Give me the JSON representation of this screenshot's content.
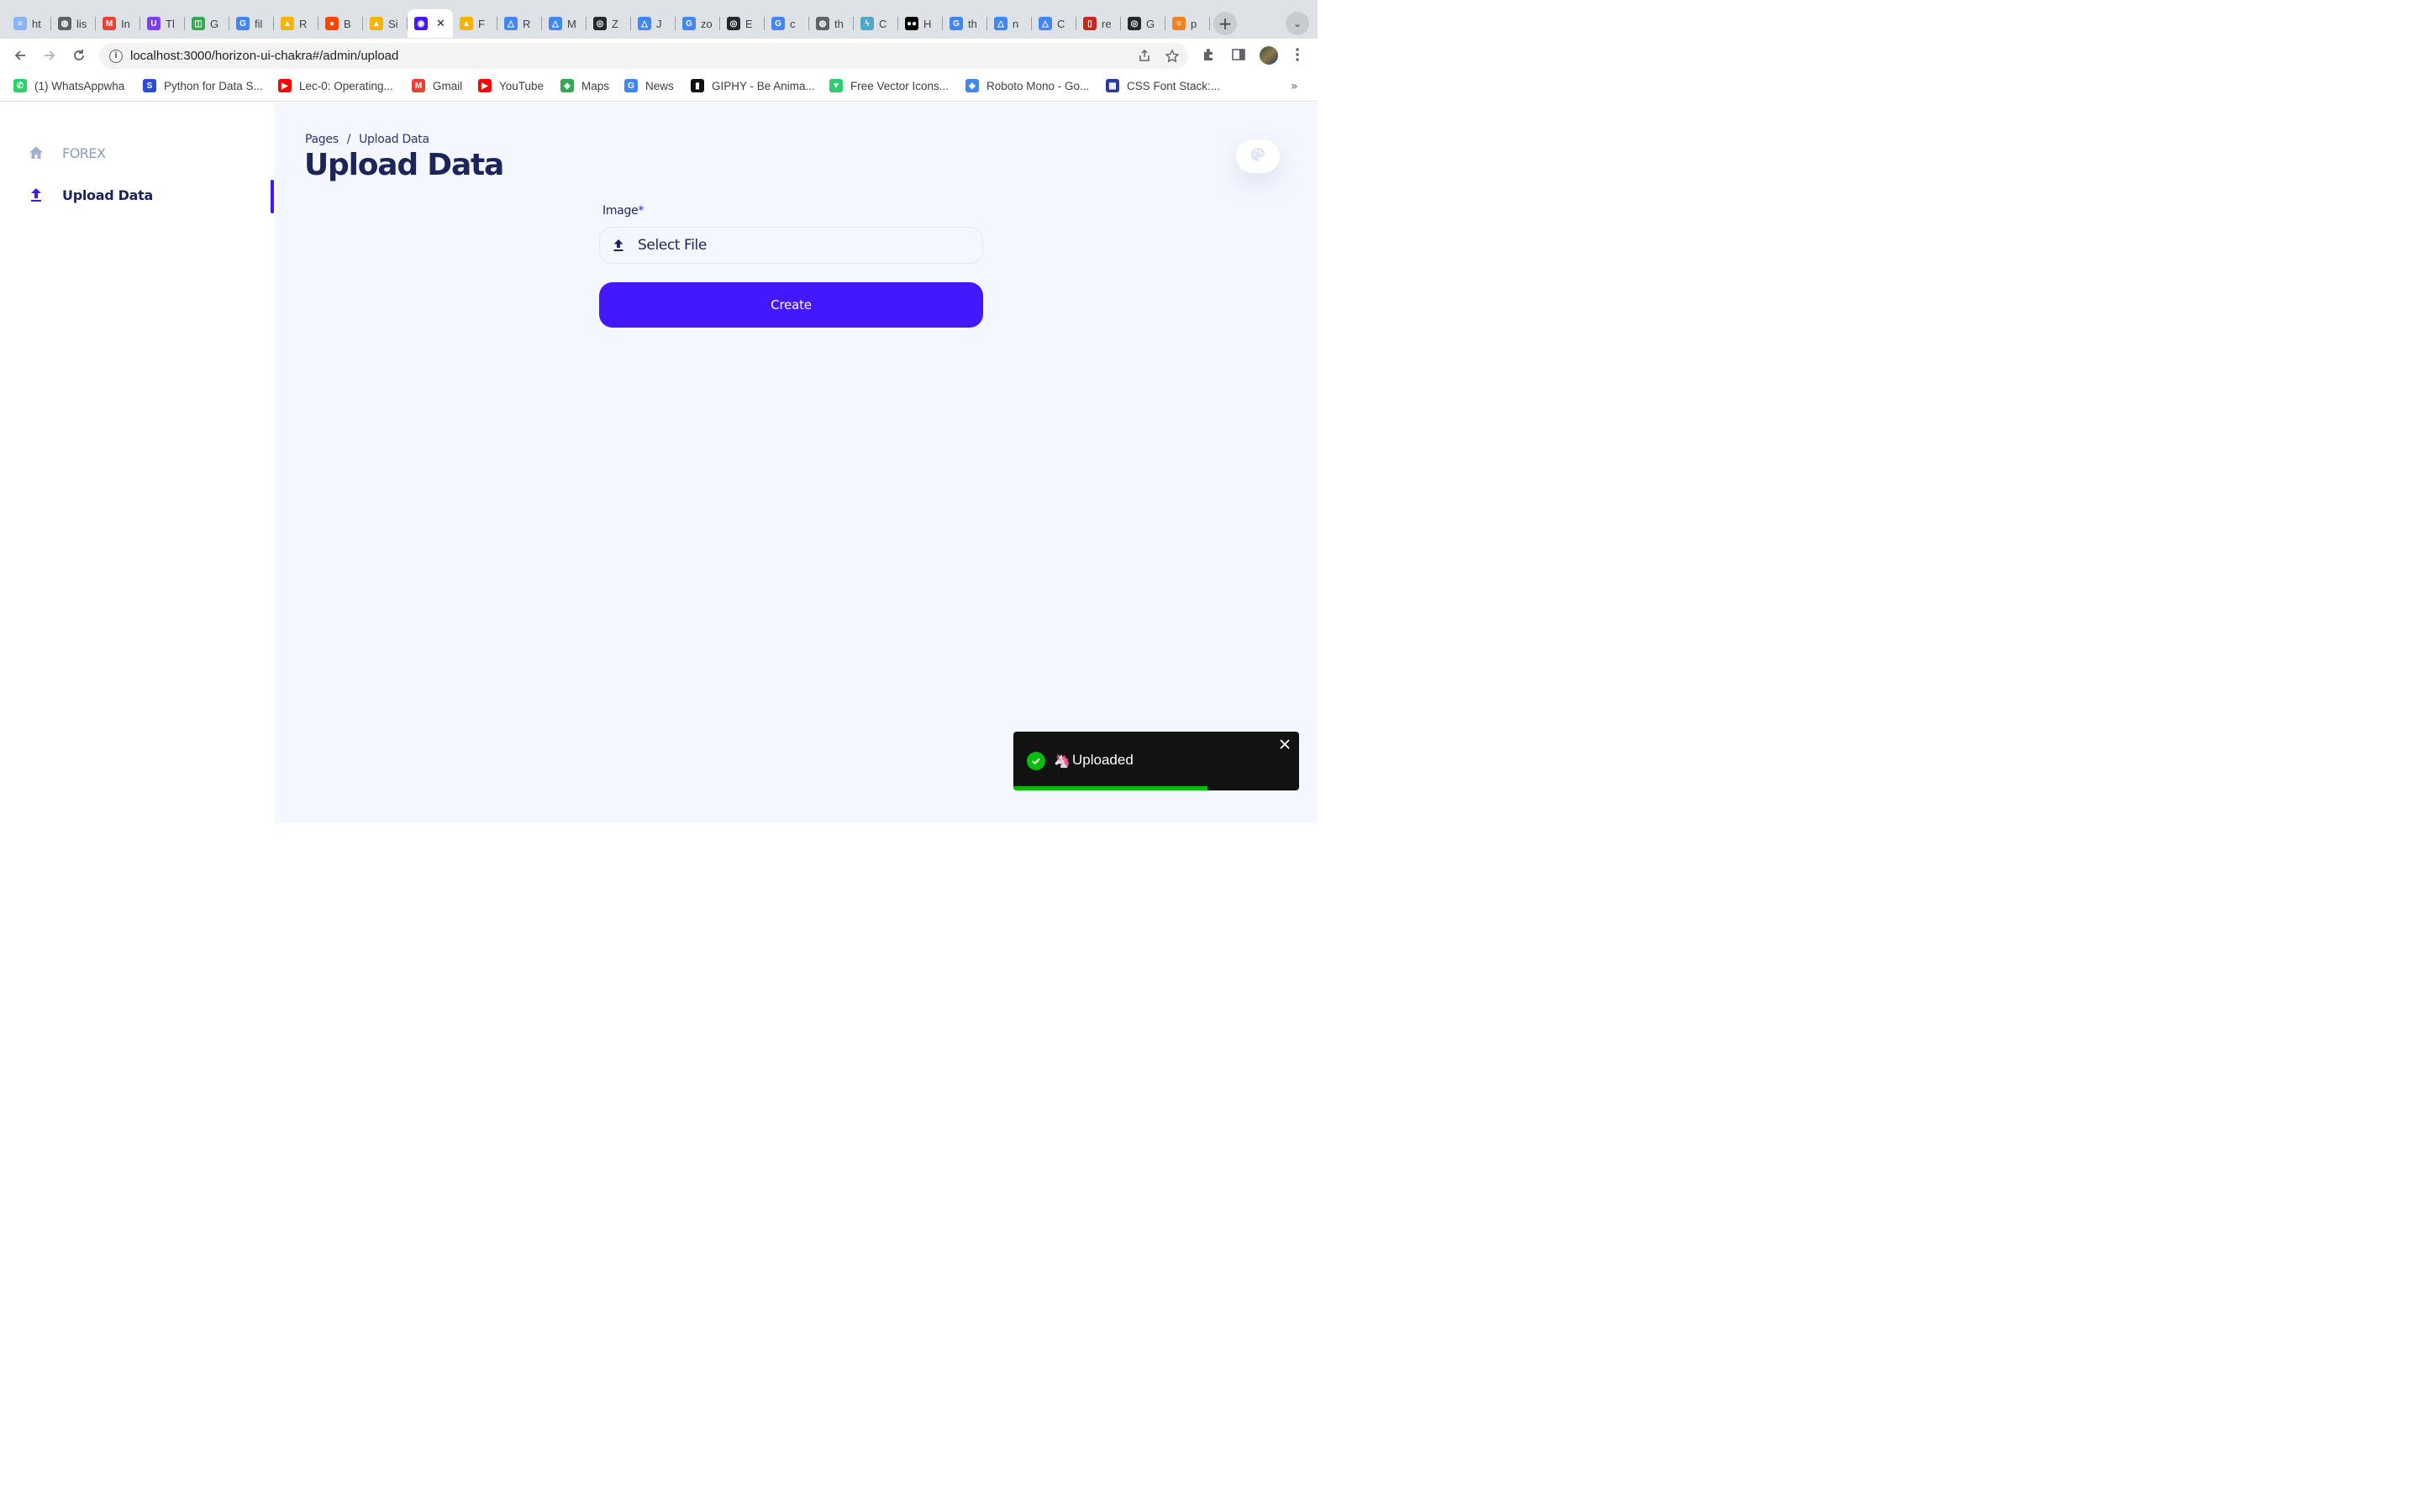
{
  "browser": {
    "tabs": [
      {
        "title": "ht",
        "color": "#8ab4f8",
        "glyph": "≡"
      },
      {
        "title": "lis",
        "color": "#5f6368",
        "glyph": "◍"
      },
      {
        "title": "In",
        "color": "#ea4335",
        "glyph": "M"
      },
      {
        "title": "Tl",
        "color": "#7e3ff2",
        "glyph": "U"
      },
      {
        "title": "G",
        "color": "#34a853",
        "glyph": "◫"
      },
      {
        "title": "fil",
        "color": "#4285f4",
        "glyph": "G"
      },
      {
        "title": "R",
        "color": "#f4b400",
        "glyph": "▲"
      },
      {
        "title": "B",
        "color": "#ff4500",
        "glyph": "●"
      },
      {
        "title": "Si",
        "color": "#f4b400",
        "glyph": "▲"
      },
      {
        "title": "",
        "color": "#4318ff",
        "glyph": "◉",
        "active": true
      },
      {
        "title": "F",
        "color": "#f4b400",
        "glyph": "▲"
      },
      {
        "title": "R",
        "color": "#4285f4",
        "glyph": "△"
      },
      {
        "title": "M",
        "color": "#4285f4",
        "glyph": "△"
      },
      {
        "title": "Z",
        "color": "#24292f",
        "glyph": "◎"
      },
      {
        "title": "J",
        "color": "#4285f4",
        "glyph": "△"
      },
      {
        "title": "zo",
        "color": "#4285f4",
        "glyph": "G"
      },
      {
        "title": "E",
        "color": "#24292f",
        "glyph": "◎"
      },
      {
        "title": "c",
        "color": "#4285f4",
        "glyph": "G"
      },
      {
        "title": "th",
        "color": "#5f6368",
        "glyph": "◍"
      },
      {
        "title": "C",
        "color": "#4fa8c5",
        "glyph": "ϟ"
      },
      {
        "title": "H",
        "color": "#000000",
        "glyph": "●●"
      },
      {
        "title": "th",
        "color": "#4285f4",
        "glyph": "G"
      },
      {
        "title": "n",
        "color": "#4285f4",
        "glyph": "△"
      },
      {
        "title": "C",
        "color": "#4285f4",
        "glyph": "△"
      },
      {
        "title": "re",
        "color": "#c5281c",
        "glyph": "▯"
      },
      {
        "title": "G",
        "color": "#24292f",
        "glyph": "◎"
      },
      {
        "title": "p",
        "color": "#f48024",
        "glyph": "≡"
      }
    ],
    "url": "localhost:3000/horizon-ui-chakra#/admin/upload",
    "bookmarks": [
      {
        "label": "(1) WhatsAppwha",
        "color": "#25d366",
        "glyph": "✆"
      },
      {
        "label": "Python for Data S...",
        "color": "#2b4bd8",
        "glyph": "S"
      },
      {
        "label": "Lec-0: Operating...",
        "color": "#ff0000",
        "glyph": "▶"
      },
      {
        "label": "Gmail",
        "color": "#ea4335",
        "glyph": "M"
      },
      {
        "label": "YouTube",
        "color": "#ff0000",
        "glyph": "▶"
      },
      {
        "label": "Maps",
        "color": "#34a853",
        "glyph": "◈"
      },
      {
        "label": "News",
        "color": "#4285f4",
        "glyph": "G"
      },
      {
        "label": "GIPHY - Be Anima...",
        "color": "#111111",
        "glyph": "▮"
      },
      {
        "label": "Free Vector Icons...",
        "color": "#2ecc71",
        "glyph": "▼"
      },
      {
        "label": "Roboto Mono - Go...",
        "color": "#4285f4",
        "glyph": "◆"
      },
      {
        "label": "CSS Font Stack:...",
        "color": "#2b3a9f",
        "glyph": "▦"
      }
    ]
  },
  "sidebar": {
    "items": [
      {
        "label": "FOREX",
        "icon": "home-icon"
      },
      {
        "label": "Upload Data",
        "icon": "upload-icon"
      }
    ]
  },
  "main": {
    "breadcrumb": {
      "root": "Pages",
      "separator": "/",
      "current": "Upload Data"
    },
    "title": "Upload Data",
    "form": {
      "image_label": "Image",
      "required_mark": "*",
      "file_button": "Select File",
      "submit_label": "Create"
    }
  },
  "toast": {
    "emoji": "🦄",
    "message": "Uploaded",
    "progress": 0.68,
    "status_color": "#07bc0c"
  },
  "colors": {
    "brand": "#4318ff",
    "heading": "#1b2559",
    "muted": "#8f9bba",
    "page_bg": "#f4f7fe"
  }
}
